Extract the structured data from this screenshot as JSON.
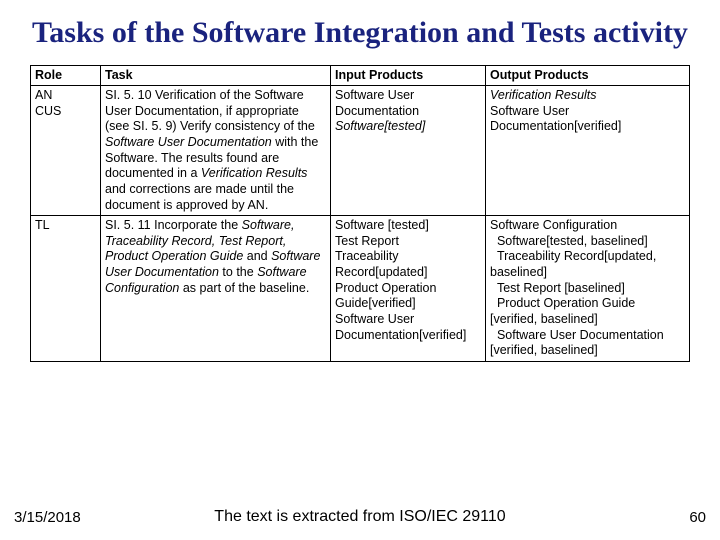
{
  "title": "Tasks of the Software Integration and Tests activity",
  "table": {
    "headers": {
      "role": "Role",
      "task": "Task",
      "input": "Input Products",
      "output": "Output Products"
    },
    "rows": [
      {
        "role": "AN\nCUS",
        "task_html": "SI. 5. 10 Verification of the Software User Documentation, if appropriate (see SI. 5. 9) Verify consistency of the <i>Software User Documentation</i> with the Software. The results found are documented in a <i>Verification Results</i> and corrections are made until the document is approved by AN.",
        "input_html": "Software User Documentation<br><i>Software[tested]</i>",
        "output_html": "<i>Verification Results</i><br>Software User Documentation[verified]"
      },
      {
        "role": "TL",
        "task_html": "SI. 5. 11 Incorporate the <i>Software, Traceability Record, Test Report, Product Operation Guide</i> and <i>Software User Documentation</i> to the <i>Software Configuration</i> as part of the baseline.",
        "input_html": "Software [tested]<br>Test Report<br>Traceability Record[updated]<br>Product Operation Guide[verified]<br>Software User Documentation[verified]",
        "output_html": "Software Configuration<br>&nbsp;&nbsp;Software[tested, baselined]<br>&nbsp;&nbsp;Traceability Record[updated, baselined]<br>&nbsp;&nbsp;Test Report [baselined]<br>&nbsp;&nbsp;Product Operation Guide [verified, baselined]<br>&nbsp;&nbsp;Software User Documentation [verified, baselined]"
      }
    ]
  },
  "footer": {
    "date": "3/15/2018",
    "caption": "The text is extracted from ISO/IEC 29110",
    "page": "60"
  }
}
